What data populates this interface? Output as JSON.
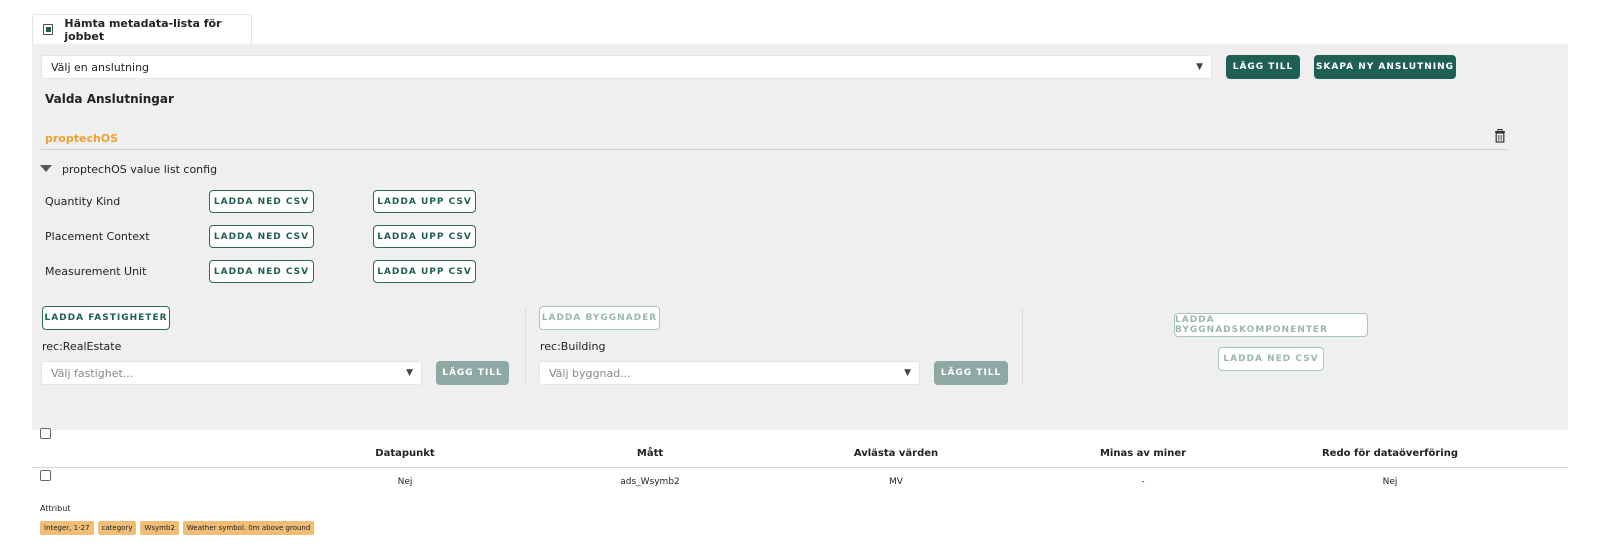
{
  "tab": {
    "label": "Hämta metadata-lista för jobbet"
  },
  "connection": {
    "select_value": "Välj en anslutning",
    "add_label": "LÄGG TILL",
    "create_label": "SKAPA NY ANSLUTNING"
  },
  "selected": {
    "heading": "Valda Anslutningar",
    "connection_name": "proptechOS",
    "accent_color": "#f0a030"
  },
  "config": {
    "title": "proptechOS value list config",
    "rows": [
      {
        "label": "Quantity Kind",
        "download": "LADDA NED CSV",
        "upload": "LADDA UPP CSV"
      },
      {
        "label": "Placement Context",
        "download": "LADDA NED CSV",
        "upload": "LADDA UPP CSV"
      },
      {
        "label": "Measurement Unit",
        "download": "LADDA NED CSV",
        "upload": "LADDA UPP CSV"
      }
    ]
  },
  "loaders": {
    "real_estate": {
      "button": "LADDA FASTIGHETER",
      "type_label": "rec:RealEstate",
      "placeholder": "Välj fastighet...",
      "add": "LÄGG TILL"
    },
    "building": {
      "button": "LADDA BYGGNADER",
      "type_label": "rec:Building",
      "placeholder": "Välj byggnad...",
      "add": "LÄGG TILL"
    },
    "components": {
      "button": "LADDA BYGGNADSKOMPONENTER",
      "download": "LADDA NED CSV"
    }
  },
  "table": {
    "headers": [
      "Datapunkt",
      "Mått",
      "Avlästa värden",
      "Minas av miner",
      "Redo för dataöverföring"
    ],
    "row": [
      "Nej",
      "ads_Wsymb2",
      "MV",
      "-",
      "Nej"
    ],
    "attr_label": "Attribut",
    "tags": [
      "Integer, 1-27",
      "category",
      "Wsymb2",
      "Weather symbol. 0m above ground"
    ]
  },
  "colors": {
    "primary": "#1f5f55",
    "tag": "#f0bd77",
    "panel": "#efefef"
  }
}
